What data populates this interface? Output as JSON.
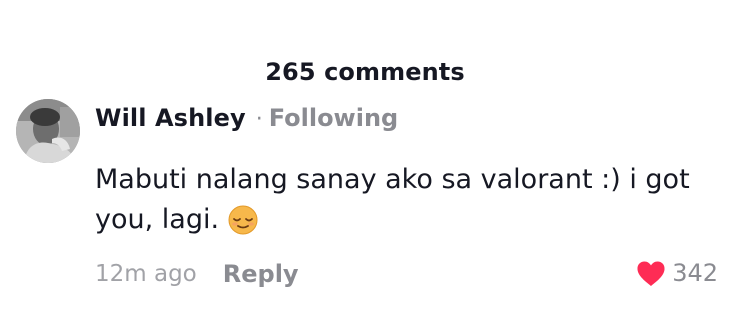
{
  "header": {
    "comment_count": "265 comments"
  },
  "comment": {
    "author": "Will Ashley",
    "separator": "·",
    "relationship": "Following",
    "text": "Mabuti nalang sanay ako sa valorant :) i got you, lagi.",
    "emoji": "relieved-face-emoji",
    "timestamp": "12m ago",
    "reply_label": "Reply",
    "like_count": "342",
    "like_icon": "heart-icon",
    "like_color": "#fe2c55"
  }
}
